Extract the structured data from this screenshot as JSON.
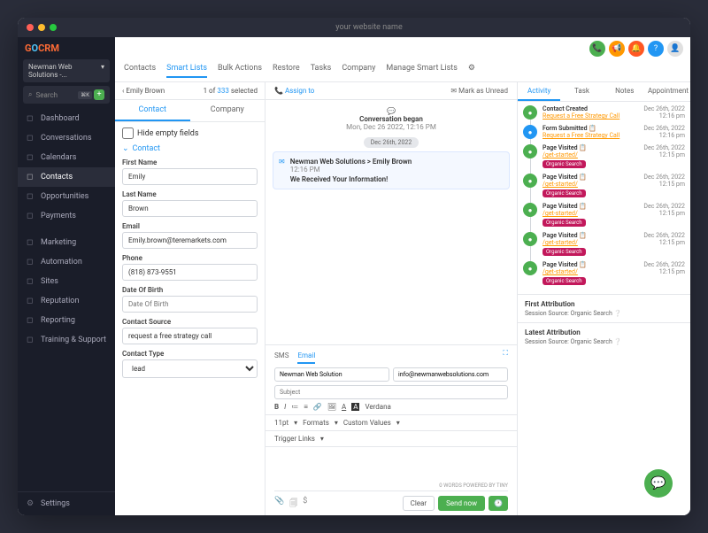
{
  "window_title": "your website name",
  "org_name": "Newman Web Solutions -...",
  "search_placeholder": "Search",
  "nav": [
    "Dashboard",
    "Conversations",
    "Calendars",
    "Contacts",
    "Opportunities",
    "Payments",
    "Marketing",
    "Automation",
    "Sites",
    "Reputation",
    "Reporting",
    "Training & Support"
  ],
  "settings_label": "Settings",
  "main_tabs": [
    "Contacts",
    "Smart Lists",
    "Bulk Actions",
    "Restore",
    "Tasks",
    "Company",
    "Manage Smart Lists"
  ],
  "record_name": "Emily Brown",
  "record_count": "1 of",
  "record_total": "333",
  "record_selected": "selected",
  "subtabs": [
    "Contact",
    "Company"
  ],
  "hide_empty": "Hide empty fields",
  "section_contact": "Contact",
  "fields": {
    "first_name_label": "First Name",
    "first_name": "Emily",
    "last_name_label": "Last Name",
    "last_name": "Brown",
    "email_label": "Email",
    "email": "Emily.brown@teremarkets.com",
    "phone_label": "Phone",
    "phone": "(818) 873-9551",
    "dob_label": "Date Of Birth",
    "dob_placeholder": "Date Of Birth",
    "source_label": "Contact Source",
    "source": "request a free strategy call",
    "type_label": "Contact Type",
    "type": "lead"
  },
  "conv": {
    "assign": "Assign to",
    "unread": "Mark as Unread",
    "began": "Conversation began",
    "began_time": "Mon, Dec 26 2022, 12:16 PM",
    "date_pill": "Dec 26th, 2022",
    "email_from": "Newman Web Solutions > Emily Brown",
    "email_time": "12:16 PM",
    "email_subject": "We Received Your Information!"
  },
  "composer": {
    "tabs": [
      "SMS",
      "Email"
    ],
    "from": "Newman Web Solution",
    "to": "info@newmanwebsolutions.com",
    "subject_placeholder": "Subject",
    "font": "Verdana",
    "fontsize": "11pt",
    "formats": "Formats",
    "custom": "Custom Values",
    "trigger": "Trigger Links",
    "tiny": "0 WORDS POWERED BY TINY",
    "clear": "Clear",
    "send": "Send now"
  },
  "activity_tabs": [
    "Activity",
    "Task",
    "Notes",
    "Appointment"
  ],
  "activities": [
    {
      "icon": "g",
      "title": "Contact Created",
      "link": "Request a Free Strategy Call",
      "badge": "",
      "date": "Dec 26th, 2022",
      "time": "12:16 pm"
    },
    {
      "icon": "b",
      "title": "Form Submitted 📋",
      "link": "Request a Free Strategy Call",
      "badge": "",
      "date": "Dec 26th, 2022",
      "time": "12:16 pm"
    },
    {
      "icon": "g",
      "title": "Page Visited 📋",
      "link": "/get-started/",
      "badge": "Organic Search",
      "date": "Dec 26th, 2022",
      "time": "12:15 pm"
    },
    {
      "icon": "g",
      "title": "Page Visited 📋",
      "link": "/get-started/",
      "badge": "Organic Search",
      "date": "Dec 26th, 2022",
      "time": "12:15 pm"
    },
    {
      "icon": "g",
      "title": "Page Visited 📋",
      "link": "/get-started/",
      "badge": "Organic Search",
      "date": "Dec 26th, 2022",
      "time": "12:15 pm"
    },
    {
      "icon": "g",
      "title": "Page Visited 📋",
      "link": "/get-started/",
      "badge": "Organic Search",
      "date": "Dec 26th, 2022",
      "time": "12:15 pm"
    },
    {
      "icon": "g",
      "title": "Page Visited 📋",
      "link": "/get-started/",
      "badge": "Organic Search",
      "date": "Dec 26th, 2022",
      "time": "12:15 pm"
    }
  ],
  "first_attr": "First Attribution",
  "latest_attr": "Latest Attribution",
  "session_src": "Session Source:",
  "session_val": "Organic Search"
}
